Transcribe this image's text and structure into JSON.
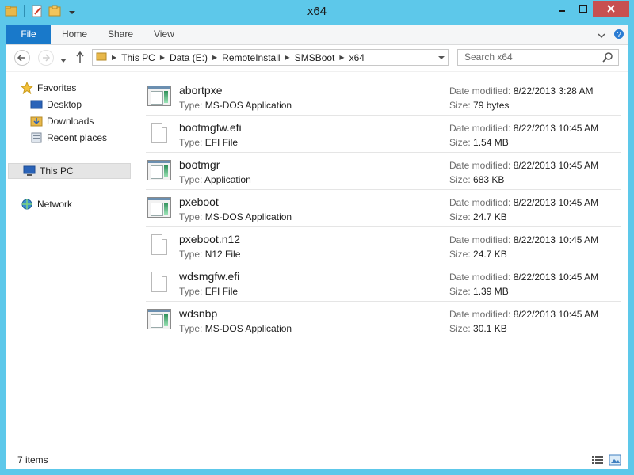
{
  "window": {
    "title": "x64"
  },
  "ribbon": {
    "tabs": [
      "File",
      "Home",
      "Share",
      "View"
    ]
  },
  "address": {
    "crumbs": [
      "This PC",
      "Data (E:)",
      "RemoteInstall",
      "SMSBoot",
      "x64"
    ],
    "search_placeholder": "Search x64"
  },
  "nav": {
    "favorites": "Favorites",
    "desktop": "Desktop",
    "downloads": "Downloads",
    "recent": "Recent places",
    "thispc": "This PC",
    "network": "Network"
  },
  "labels": {
    "type": "Type:",
    "date_modified": "Date modified:",
    "size": "Size:"
  },
  "files": [
    {
      "name": "abortpxe",
      "type": "MS-DOS Application",
      "date": "8/22/2013 3:28 AM",
      "size": "79 bytes",
      "icon": "app"
    },
    {
      "name": "bootmgfw.efi",
      "type": "EFI File",
      "date": "8/22/2013 10:45 AM",
      "size": "1.54 MB",
      "icon": "doc"
    },
    {
      "name": "bootmgr",
      "type": "Application",
      "date": "8/22/2013 10:45 AM",
      "size": "683 KB",
      "icon": "app"
    },
    {
      "name": "pxeboot",
      "type": "MS-DOS Application",
      "date": "8/22/2013 10:45 AM",
      "size": "24.7 KB",
      "icon": "app"
    },
    {
      "name": "pxeboot.n12",
      "type": "N12 File",
      "date": "8/22/2013 10:45 AM",
      "size": "24.7 KB",
      "icon": "doc"
    },
    {
      "name": "wdsmgfw.efi",
      "type": "EFI File",
      "date": "8/22/2013 10:45 AM",
      "size": "1.39 MB",
      "icon": "doc"
    },
    {
      "name": "wdsnbp",
      "type": "MS-DOS Application",
      "date": "8/22/2013 10:45 AM",
      "size": "30.1 KB",
      "icon": "app"
    }
  ],
  "status": {
    "count": "7 items"
  },
  "colors": {
    "frame": "#5dc8ea",
    "file_tab": "#1979ca",
    "close_button": "#c75050"
  }
}
